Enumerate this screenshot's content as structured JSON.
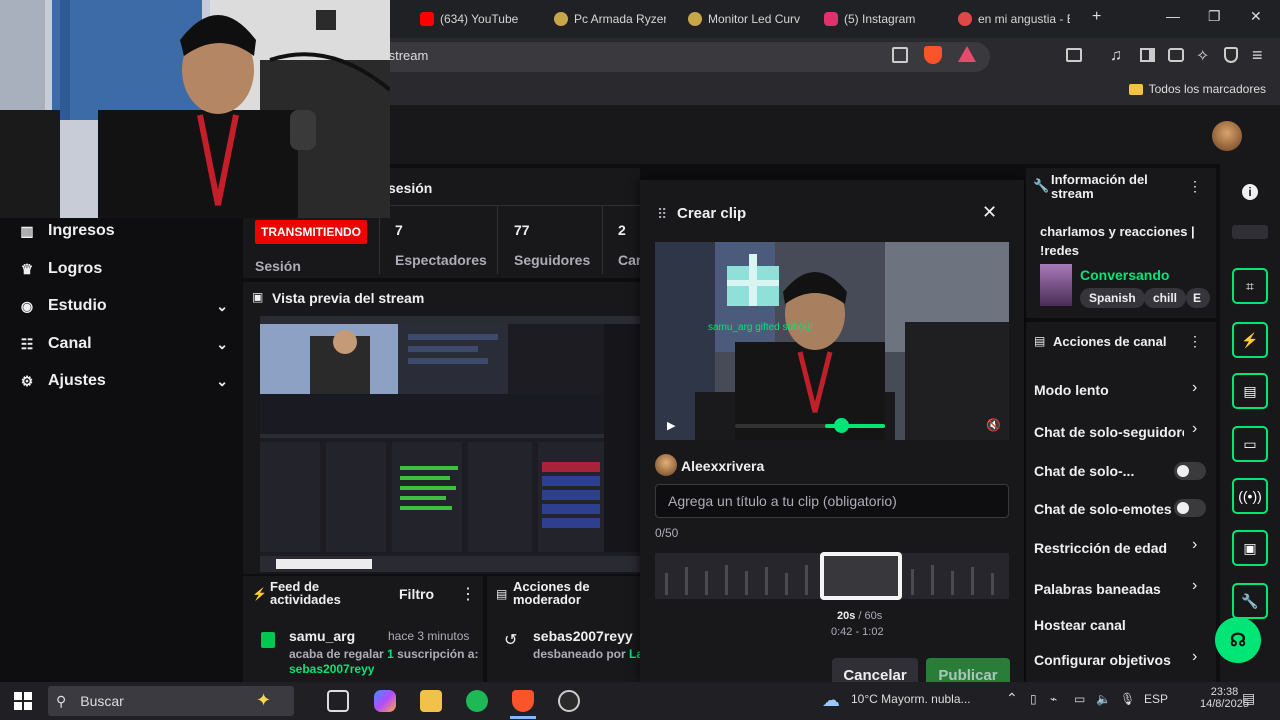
{
  "browser": {
    "tabs": [
      {
        "label": "(634) YouTube",
        "color": "#ff0000"
      },
      {
        "label": "Pc Armada Ryzen",
        "color": "#c9a64a"
      },
      {
        "label": "Monitor Led Curv",
        "color": "#c9a64a"
      },
      {
        "label": "(5) Instagram",
        "color": "#e1306c"
      },
      {
        "label": "en mi angustia - E",
        "color": "#e04848"
      }
    ],
    "new_tab": "+",
    "window_controls": {
      "minimize": "—",
      "maximize": "❐",
      "close": "✕"
    },
    "url": "/stream",
    "bookmarks_label": "Todos los marcadores"
  },
  "sidebar": {
    "items": [
      {
        "label": "Ingresos",
        "icon": "earnings-icon"
      },
      {
        "label": "Logros",
        "icon": "trophy-icon"
      },
      {
        "label": "Estudio",
        "icon": "studio-icon"
      },
      {
        "label": "Canal",
        "icon": "channel-icon"
      },
      {
        "label": "Ajustes",
        "icon": "gear-icon"
      }
    ]
  },
  "session": {
    "title_fragment": "sesión",
    "live_badge": "TRANSMITIENDO",
    "session_label": "Sesión",
    "stats": [
      {
        "value": "7",
        "label": "Espectadores"
      },
      {
        "value": "77",
        "label": "Seguidores"
      },
      {
        "value": "2",
        "label": "Car"
      }
    ]
  },
  "preview": {
    "title": "Vista previa del stream"
  },
  "activity_feed": {
    "title_line1": "Feed de",
    "title_line2": "actividades",
    "filter_label": "Filtro",
    "event": {
      "user": "samu_arg",
      "time": "hace 3 minutos",
      "text_prefix": "acaba de regalar ",
      "count": "1",
      "text_suffix": " suscripción a:",
      "recipient": "sebas2007reyy"
    }
  },
  "mod_actions": {
    "title_line1": "Acciones de",
    "title_line2": "moderador",
    "event": {
      "user": "sebas2007reyy",
      "text": "desbaneado por ",
      "by": "Lar"
    }
  },
  "clip_modal": {
    "title": "Crear clip",
    "video_overlay_text": "samu_arg gifted  sub(s)!",
    "author": "Aleexxrivera",
    "title_placeholder": "Agrega un título a tu clip (obligatorio)",
    "char_count": "0/50",
    "duration": "20s",
    "max_duration": "/ 60s",
    "range": "0:42 - 1:02",
    "cancel_label": "Cancelar",
    "publish_label": "Publicar"
  },
  "stream_info": {
    "title_line1": "Información del",
    "title_line2": "stream",
    "stream_title_line1": "charlamos y reacciones |",
    "stream_title_line2": "!redes",
    "category": "Conversando",
    "tags": [
      "Spanish",
      "chill",
      "E"
    ]
  },
  "channel_actions": {
    "title": "Acciones de canal",
    "items": [
      {
        "label": "Modo lento",
        "type": "chevron"
      },
      {
        "label": "Chat de solo-seguidores",
        "type": "chevron"
      },
      {
        "label": "Chat de solo-...",
        "type": "toggle"
      },
      {
        "label": "Chat de solo-emotes",
        "type": "toggle"
      },
      {
        "label": "Restricción de edad",
        "type": "chevron"
      },
      {
        "label": "Palabras baneadas",
        "type": "chevron"
      },
      {
        "label": "Hostear canal",
        "type": "none"
      },
      {
        "label": "Configurar objetivos",
        "type": "chevron"
      }
    ]
  },
  "taskbar": {
    "search_placeholder": "Buscar",
    "weather": "10°C  Mayorm. nubla...",
    "language": "ESP",
    "time": "23:38",
    "date": "14/8/2025"
  },
  "colors": {
    "accent": "#00e676",
    "live": "#eb0400",
    "panel": "#18181b",
    "bg": "#0e0e10"
  }
}
